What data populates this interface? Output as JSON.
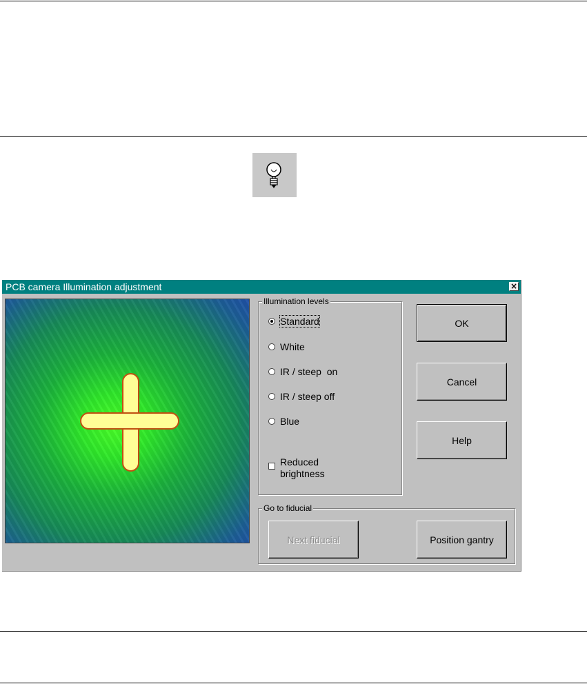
{
  "dialog": {
    "title": "PCB camera Illumination adjustment",
    "close_label": "×"
  },
  "icons": {
    "tip": "lightbulb-icon",
    "close": "close-icon"
  },
  "colors": {
    "titlebar": "#008080",
    "dialog_bg": "#c0c0c0",
    "fiducial_fill": "#ffff96",
    "fiducial_outline": "#c05010"
  },
  "illumination": {
    "legend": "Illumination levels",
    "options": [
      {
        "label": "Standard",
        "checked": true
      },
      {
        "label": "White",
        "checked": false
      },
      {
        "label": "IR / steep  on",
        "checked": false
      },
      {
        "label": "IR / steep off",
        "checked": false
      },
      {
        "label": "Blue",
        "checked": false
      }
    ],
    "reduced_brightness_label": "Reduced brightness",
    "reduced_brightness_checked": false
  },
  "buttons": {
    "ok": "OK",
    "cancel": "Cancel",
    "help": "Help"
  },
  "fiducial": {
    "legend": "Go to fiducial",
    "next_label": "Next fiducial",
    "position_label": "Position gantry"
  }
}
